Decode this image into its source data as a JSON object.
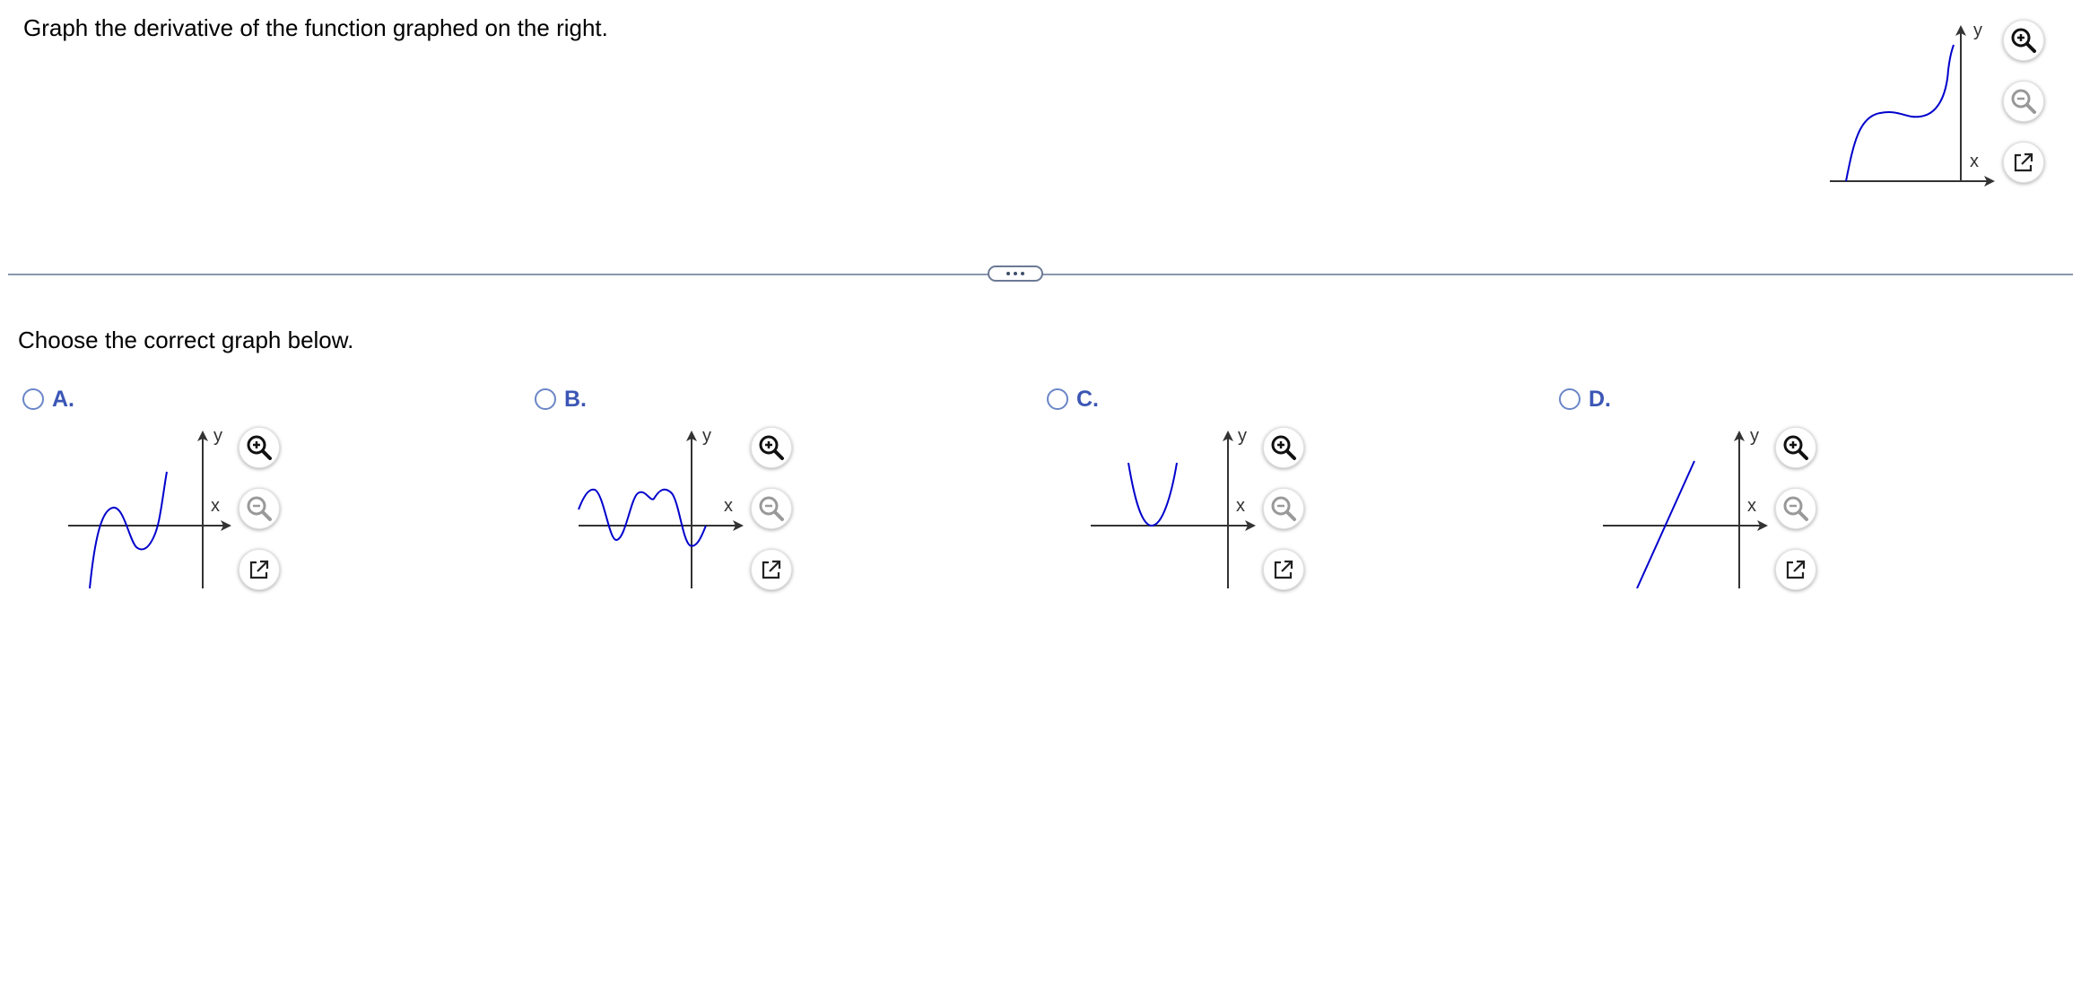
{
  "question": {
    "text": "Graph the derivative of the function graphed on the right."
  },
  "given_graph": {
    "x_label": "x",
    "y_label": "y",
    "curve_color": "#0000cc"
  },
  "toolbar_icons": {
    "zoom_in": "zoom-in-icon",
    "zoom_out": "zoom-out-icon",
    "popout": "popout-icon"
  },
  "divider": {
    "handle_icon": "ellipsis-icon"
  },
  "prompt": {
    "text": "Choose the correct graph below."
  },
  "choices": [
    {
      "letter": "A.",
      "x_label": "x",
      "y_label": "y"
    },
    {
      "letter": "B.",
      "x_label": "x",
      "y_label": "y"
    },
    {
      "letter": "C.",
      "x_label": "x",
      "y_label": "y"
    },
    {
      "letter": "D.",
      "x_label": "x",
      "y_label": "y"
    }
  ],
  "colors": {
    "curve": "#0000cc",
    "axis": "#333333",
    "choice_letter": "#3b56b5",
    "radio_border": "#6a86c7",
    "divider": "#8a97ad"
  }
}
